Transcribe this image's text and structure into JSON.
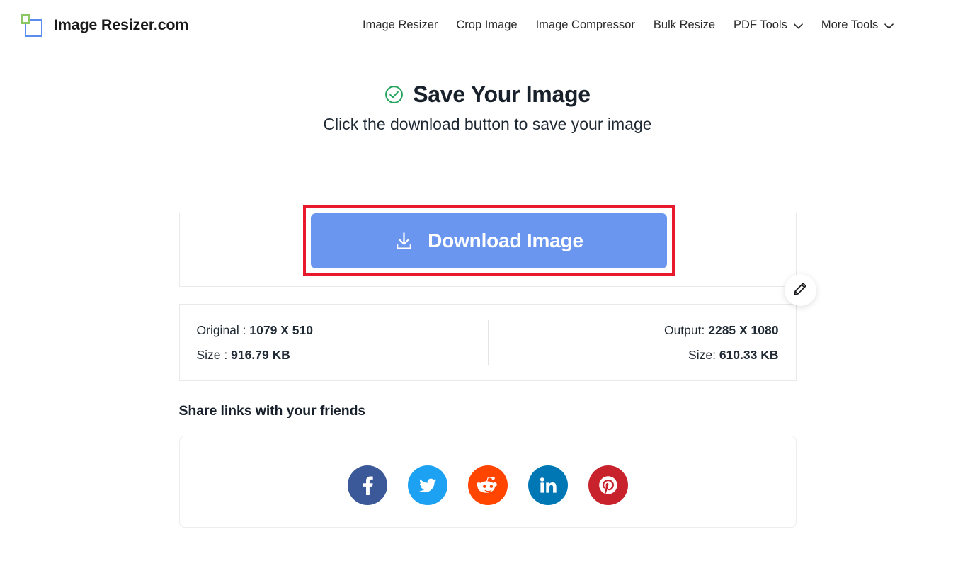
{
  "header": {
    "brand": {
      "name": "Image Resizer.com",
      "logo_icon": "overlapping-squares-logo",
      "logo_green": "#8bc863",
      "logo_blue": "#5b8def"
    },
    "nav": [
      {
        "label": "Image Resizer",
        "has_dropdown": false
      },
      {
        "label": "Crop Image",
        "has_dropdown": false
      },
      {
        "label": "Image Compressor",
        "has_dropdown": false
      },
      {
        "label": "Bulk Resize",
        "has_dropdown": false
      },
      {
        "label": "PDF Tools",
        "has_dropdown": true,
        "icon": "chevron-down-icon"
      },
      {
        "label": "More Tools",
        "has_dropdown": true,
        "icon": "chevron-down-icon"
      }
    ]
  },
  "main": {
    "heading": "Save Your Image",
    "heading_icon": "circle-check-icon",
    "heading_icon_color": "#22a45d",
    "subheading": "Click the download button to save your image",
    "download": {
      "button_label": "Download Image",
      "button_icon": "download-icon",
      "button_color": "#6b96ef",
      "highlight_color": "#e8192c"
    },
    "edit_button": {
      "icon": "pencil-icon",
      "title": "Edit"
    },
    "info": {
      "original_label": "Original :",
      "original_value": "1079 X 510",
      "original_size_label": "Size :",
      "original_size_value": "916.79 KB",
      "output_label": "Output:",
      "output_value": "2285 X 1080",
      "output_size_label": "Size:",
      "output_size_value": "610.33 KB"
    },
    "share": {
      "title": "Share links with your friends",
      "networks": [
        {
          "name": "Facebook",
          "icon": "facebook-icon",
          "color": "#3b5998"
        },
        {
          "name": "Twitter",
          "icon": "twitter-icon",
          "color": "#1da1f2"
        },
        {
          "name": "Reddit",
          "icon": "reddit-icon",
          "color": "#ff4500"
        },
        {
          "name": "LinkedIn",
          "icon": "linkedin-icon",
          "color": "#0077b5"
        },
        {
          "name": "Pinterest",
          "icon": "pinterest-icon",
          "color": "#c8232c"
        }
      ]
    }
  }
}
